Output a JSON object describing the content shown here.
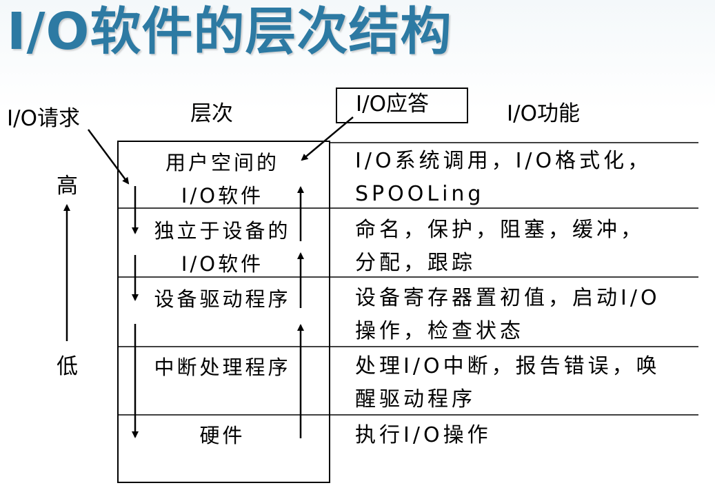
{
  "slide": {
    "title": "I/O软件的层次结构"
  },
  "labels": {
    "request": "I/O请求",
    "layer_header": "层次",
    "answer": "I/O应答",
    "function_header": "I/O功能",
    "high": "高",
    "low": "低"
  },
  "layers": [
    {
      "line1": "用户空间的",
      "line2": "I/O软件"
    },
    {
      "line1": "独立于设备的",
      "line2": "I/O软件"
    },
    {
      "line1": "设备驱动程序",
      "line2": ""
    },
    {
      "line1": "中断处理程序",
      "line2": ""
    },
    {
      "line1": "硬件",
      "line2": ""
    }
  ],
  "functions": [
    {
      "line1": "I/O系统调用，I/O格式化，",
      "line2": "SPOOLing"
    },
    {
      "line1": "命名，保护，阻塞，缓冲，",
      "line2": "分配，跟踪"
    },
    {
      "line1": "设备寄存器置初值，启动I/O",
      "line2": "操作，检查状态"
    },
    {
      "line1": "处理I/O中断，报告错误，唤",
      "line2": "醒驱动程序"
    },
    {
      "line1": "执行I/O操作",
      "line2": ""
    }
  ]
}
